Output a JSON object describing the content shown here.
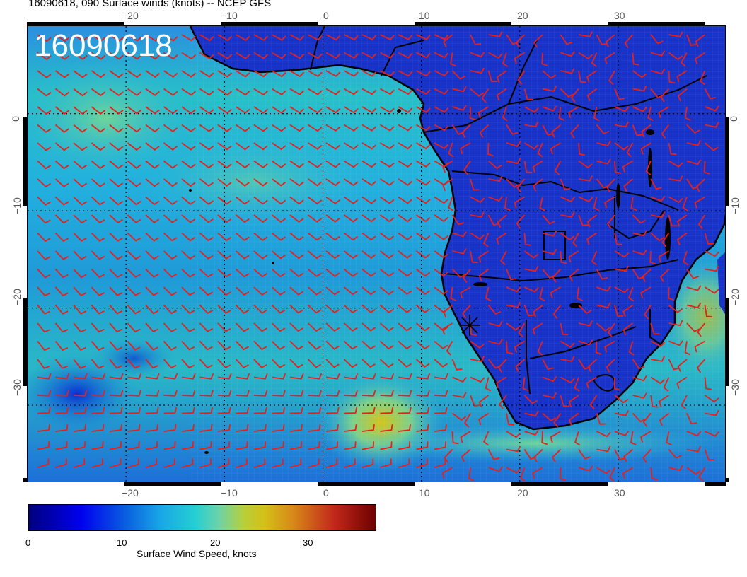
{
  "title": "16090618, 090 Surface winds (knots) -- NCEP GFS",
  "stamp": "16090618",
  "map": {
    "lon_range": [
      -30,
      41
    ],
    "lat_range": [
      -38,
      9
    ],
    "barb_color": "#e8201a",
    "land_color": "#1028b0",
    "ocean_color": "#1fa8d8",
    "coastline_color": "#000000",
    "gridline_style": "dotted"
  },
  "axes": {
    "top_ticks": [
      "−20",
      "−10",
      "0",
      "10",
      "20",
      "30"
    ],
    "bottom_ticks": [
      "−20",
      "−10",
      "0",
      "10",
      "20",
      "30"
    ],
    "left_ticks": [
      "0",
      "−10",
      "−20",
      "−30"
    ],
    "right_ticks": [
      "0",
      "−10",
      "−20",
      "−30"
    ]
  },
  "colorbar": {
    "label": "Surface Wind Speed, knots",
    "ticks": [
      "0",
      "10",
      "20",
      "30"
    ],
    "range": [
      0,
      37
    ]
  }
}
